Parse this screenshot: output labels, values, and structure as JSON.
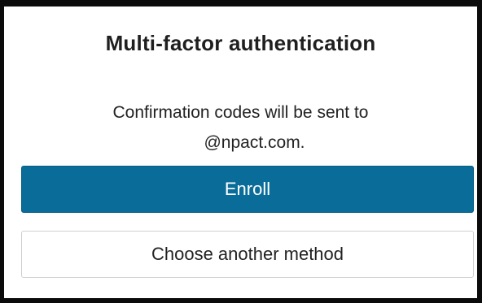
{
  "dialog": {
    "title": "Multi-factor authentication",
    "message_line1": "Confirmation codes will be sent to",
    "message_line2": "@npact.com.",
    "primary_button": "Enroll",
    "secondary_button": "Choose another method"
  },
  "colors": {
    "primary": "#0a6c98",
    "frame_border": "#0b0b0b",
    "secondary_border": "#cfcfcf"
  }
}
